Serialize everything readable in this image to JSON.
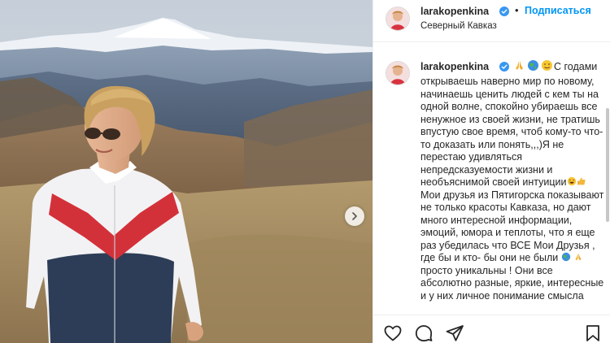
{
  "post": {
    "username": "larakopenkina",
    "follow_label": "Подписаться",
    "separator": "•",
    "location": "Северный Кавказ"
  },
  "caption": {
    "username": "larakopenkina",
    "lead_text": "С годами",
    "body": "открываешь наверно мир по новому,\nначинаешь ценить людей с кем ты на\nодной волне, спокойно убираешь все\nненужное из своей жизни, не тратишь\nвпустую свое время, чтоб кому-то что-\nто доказать или понять,,,)Я не\nперестаю удивляться\nнепредсказуемости жизни и\nнеобъяснимой своей интуиции",
    "body2": "\nМои друзья из Пятигорска показывают\nне только красоты Кавказа, но дают\nмного интересной информации,\nэмоций, юмора и теплоты, что я еще\nраз убедилась что ВСЕ Мои Друзья ,\nгде бы и кто- бы они не были ",
    "body3": "\nпросто уникальны ! Они все\nабсолютно разные, яркие, интересные\nи у них личное понимание смысла"
  },
  "icons": {
    "verified": "verified-badge-icon",
    "pray": "folded-hands-emoji",
    "globe": "globe-emoji",
    "wink": "winking-face-emoji",
    "laugh": "laughing-face-emoji",
    "thumbs": "thumbs-up-emoji",
    "like": "heart-icon",
    "comment": "comment-icon",
    "share": "paper-plane-icon",
    "save": "bookmark-icon",
    "carousel_next": "chevron-right-icon"
  },
  "colors": {
    "accent": "#0095f6",
    "verified": "#3897f0",
    "text": "#262626",
    "border": "#efefef"
  }
}
